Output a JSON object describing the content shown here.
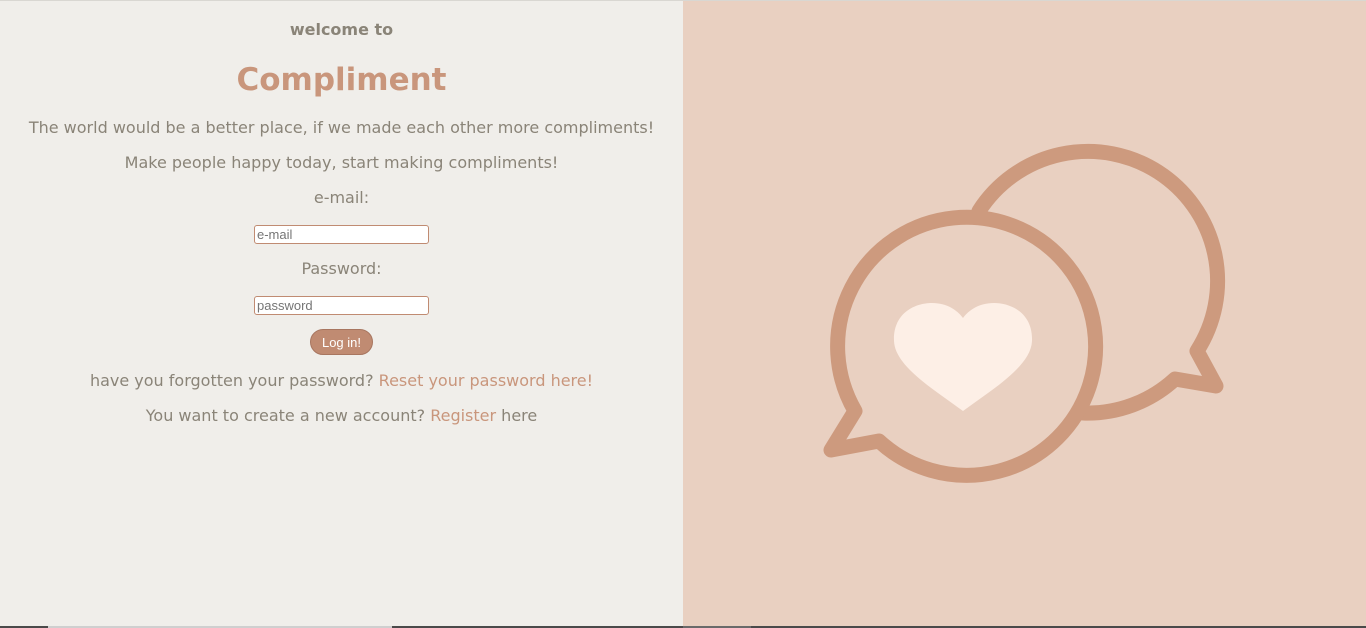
{
  "login": {
    "welcome": "welcome to",
    "app_name": "Compliment",
    "tagline_1": "The world would be a better place, if we made each other more compliments!",
    "tagline_2": "Make people happy today, start making compliments!",
    "email_label": "e-mail:",
    "email_placeholder": "e-mail",
    "password_label": "Password:",
    "password_placeholder": "password",
    "login_button": "Log in!",
    "forgot_text": "have you forgotten your password?",
    "reset_link": "Reset your password here!",
    "register_prefix": "You want to create a new account?",
    "register_link": "Register",
    "register_suffix": "here"
  },
  "illustration": {
    "icon": "chat-bubbles-heart-icon"
  },
  "colors": {
    "left_bg": "#f0eeea",
    "right_bg": "#e9d0c1",
    "accent": "#c9967c",
    "text": "#8a8478",
    "heart": "#fdefe6"
  }
}
